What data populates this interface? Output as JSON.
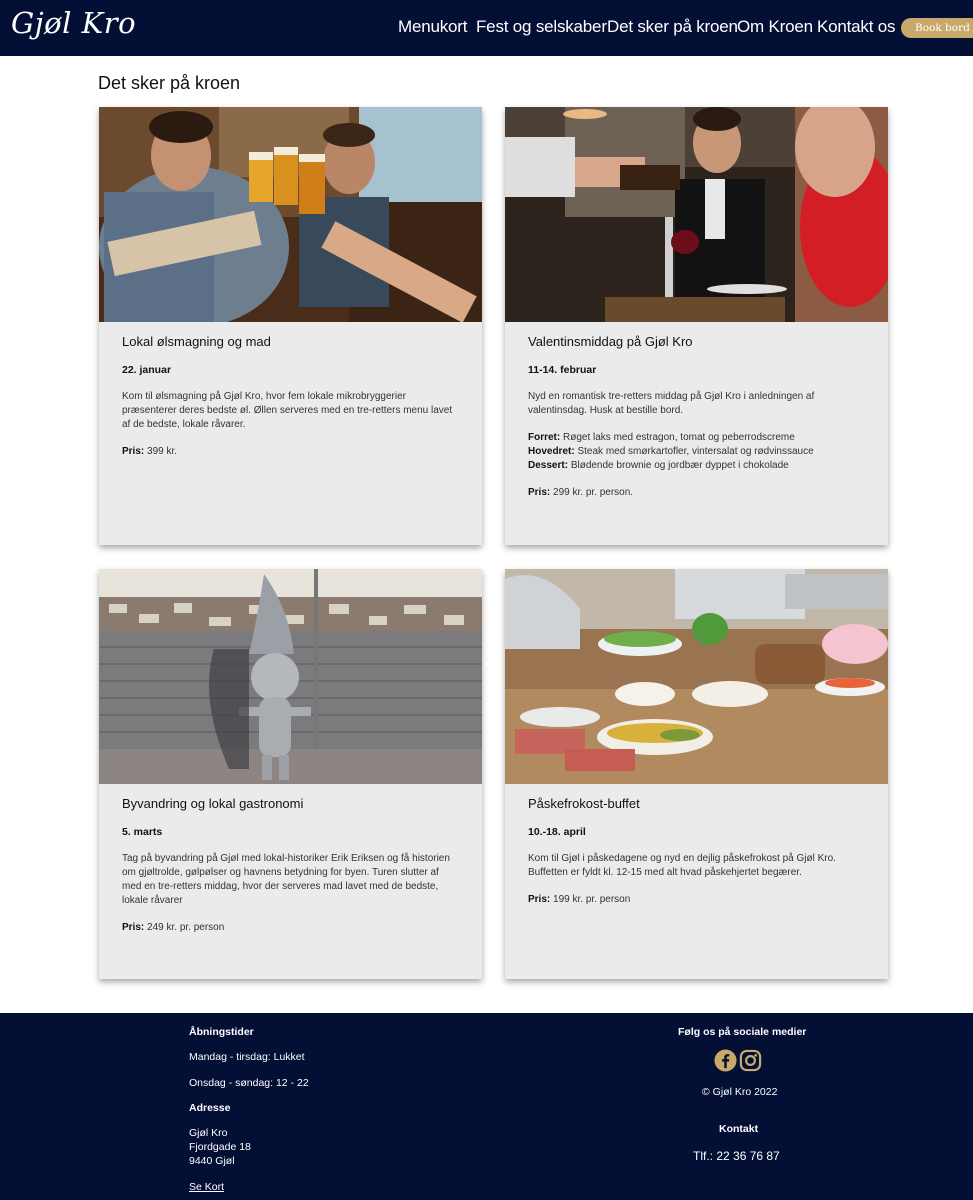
{
  "header": {
    "logo": "Gjøl Kro",
    "nav": [
      "Menukort",
      "Fest og selskaber",
      "Det sker på kroen",
      "Om Kroen",
      "Kontakt os"
    ],
    "book_button": "Book bord"
  },
  "page_title": "Det sker på kroen",
  "events": [
    {
      "title": "Lokal ølsmagning og mad",
      "date": "22. januar",
      "text": "Kom til ølsmagning på Gjøl Kro, hvor fem lokale mikrobryggerier præsenterer deres bedste øl. Øllen serveres med en tre-retters menu lavet af de bedste, lokale råvarer.",
      "price_label": "Pris:",
      "price": "399 kr."
    },
    {
      "title": "Valentinsmiddag på Gjøl Kro",
      "date": "11-14. februar",
      "text": "Nyd en romantisk tre-retters middag på Gjøl Kro i anledningen af valentinsdag. Husk at bestille bord.",
      "menu": [
        {
          "label": "Forret:",
          "value": "Røget laks med estragon, tomat og peberrodscreme"
        },
        {
          "label": "Hovedret:",
          "value": "Steak med smørkartofler, vintersalat og rødvinssauce"
        },
        {
          "label": "Dessert:",
          "value": "Blødende brownie og jordbær dyppet i chokolade"
        }
      ],
      "price_label": "Pris:",
      "price": "299 kr. pr. person."
    },
    {
      "title": "Byvandring og lokal gastronomi",
      "date": "5. marts",
      "text": "Tag på byvandring på Gjøl med lokal-historiker Erik Eriksen og få historien om gjøltrolde, gølpølser og havnens betydning for byen. Turen slutter af med en tre-retters middag, hvor der serveres mad lavet med de bedste, lokale råvarer",
      "price_label": "Pris:",
      "price": "249 kr. pr. person"
    },
    {
      "title": "Påskefrokost-buffet",
      "date": "10.-18. april",
      "text": "Kom til Gjøl i påskedagene og nyd en dejlig påskefrokost på Gjøl Kro. Buffetten er fyldt kl. 12-15 med alt hvad påskehjertet begærer.",
      "price_label": "Pris:",
      "price": "199 kr. pr. person"
    }
  ],
  "footer": {
    "hours_heading": "Åbningstider",
    "hours_1": "Mandag - tirsdag: Lukket",
    "hours_2": "Onsdag - søndag: 12 - 22",
    "address_heading": "Adresse",
    "address_1": "Gjøl Kro",
    "address_2": "Fjordgade 18",
    "address_3": "9440 Gjøl",
    "map_link": "Se Kort",
    "social_heading": "Følg os på sociale medier",
    "social_icons": [
      "facebook-icon",
      "instagram-icon"
    ],
    "copyright": "© Gjøl Kro 2022",
    "contact_heading": "Kontakt",
    "phone": "Tlf.: 22 36 76 87"
  },
  "colors": {
    "header_bg": "#030f35",
    "card_bg": "#ebebeb",
    "accent_gold": "#c9a96a"
  }
}
